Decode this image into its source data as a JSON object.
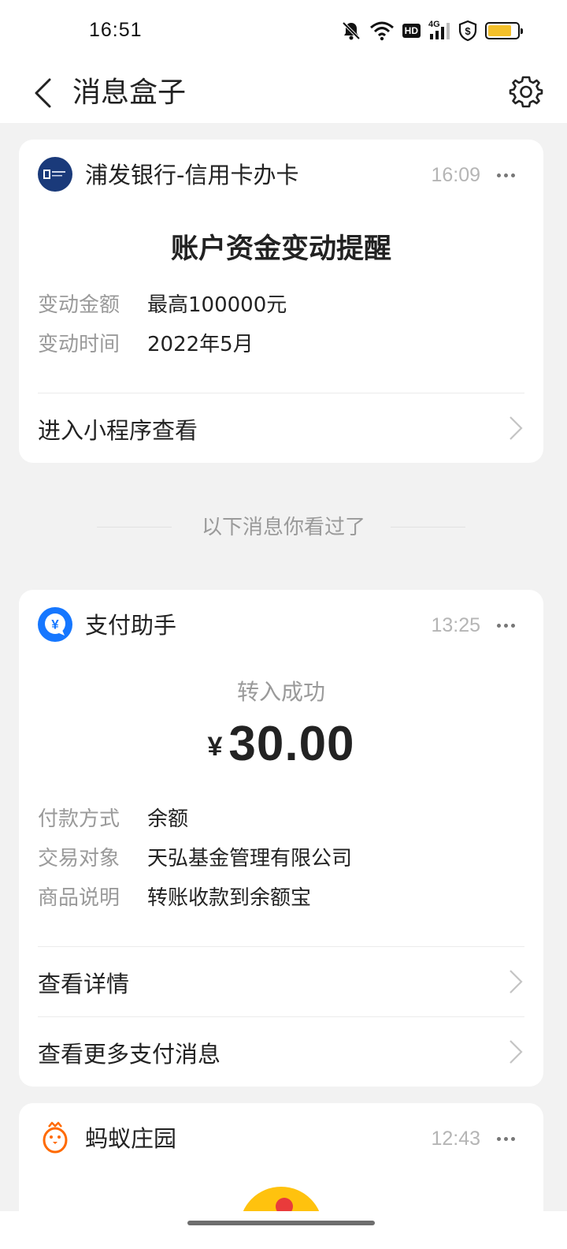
{
  "status_bar": {
    "time": "16:51",
    "hd_label": "HD",
    "network_label": "4G",
    "battery_level": 0.8,
    "battery_color": "#f4c02a"
  },
  "header": {
    "title": "消息盒子",
    "back_icon": "chevron-left-icon",
    "settings_icon": "gear-icon"
  },
  "messages": [
    {
      "sender": "浦发银行-信用卡办卡",
      "time": "16:09",
      "logo_icon": "spdb-bank-logo",
      "logo_color": "#1a3a7a",
      "title": "账户资金变动提醒",
      "fields": [
        {
          "key": "变动金额",
          "value": "最高100000元"
        },
        {
          "key": "变动时间",
          "value": "2022年5月"
        }
      ],
      "actions": [
        {
          "label": "进入小程序查看"
        }
      ]
    },
    {
      "sender": "支付助手",
      "time": "13:25",
      "logo_icon": "yuan-icon",
      "logo_color": "#1677ff",
      "subtitle": "转入成功",
      "currency_symbol": "¥",
      "amount": "30.00",
      "fields": [
        {
          "key": "付款方式",
          "value": "余额"
        },
        {
          "key": "交易对象",
          "value": "天弘基金管理有限公司"
        },
        {
          "key": "商品说明",
          "value": "转账收款到余额宝"
        }
      ],
      "actions": [
        {
          "label": "查看详情"
        },
        {
          "label": "查看更多支付消息"
        }
      ]
    },
    {
      "sender": "蚂蚁庄园",
      "time": "12:43",
      "logo_icon": "chick-icon",
      "logo_color": "#ff6a00"
    }
  ],
  "separator_text": "以下消息你看过了"
}
